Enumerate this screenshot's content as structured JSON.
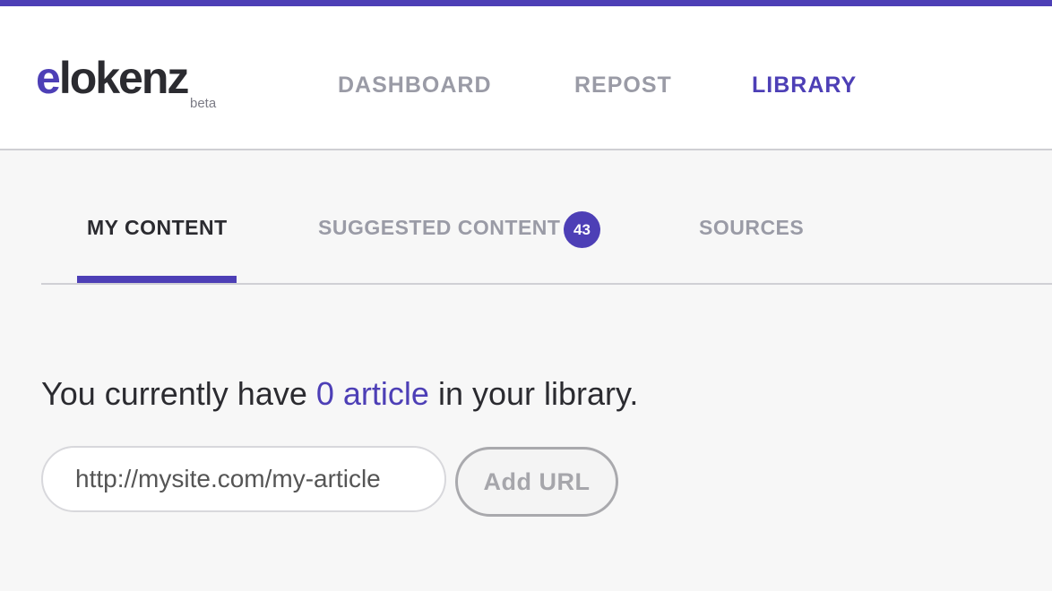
{
  "brand": {
    "logo_e": "e",
    "logo_rest": "lokenz",
    "beta": "beta",
    "accent_color": "#4d3fb6"
  },
  "nav": {
    "items": [
      {
        "label": "DASHBOARD",
        "active": false
      },
      {
        "label": "REPOST",
        "active": false
      },
      {
        "label": "LIBRARY",
        "active": true
      }
    ]
  },
  "tabs": {
    "items": [
      {
        "label": "MY CONTENT",
        "active": true
      },
      {
        "label": "SUGGESTED CONTENT",
        "active": false,
        "badge": "43"
      },
      {
        "label": "SOURCES",
        "active": false
      }
    ]
  },
  "library": {
    "summary_prefix": "You currently have ",
    "summary_count": "0 article",
    "summary_suffix": " in your library."
  },
  "add_url": {
    "placeholder": "http://mysite.com/my-article",
    "value": "",
    "button_label": "Add URL"
  }
}
